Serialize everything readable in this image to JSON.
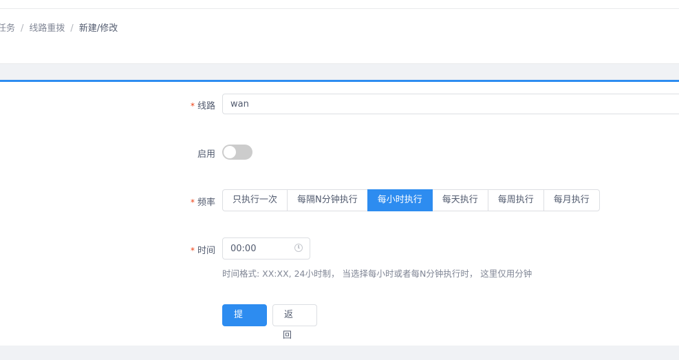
{
  "breadcrumb": {
    "items": [
      "任务",
      "线路重拨",
      "新建/修改"
    ],
    "separator": "/"
  },
  "form": {
    "line": {
      "label": "线路",
      "required": true,
      "value": "wan"
    },
    "enable": {
      "label": "启用",
      "on": false
    },
    "frequency": {
      "label": "频率",
      "required": true,
      "options": [
        "只执行一次",
        "每隔N分钟执行",
        "每小时执行",
        "每天执行",
        "每周执行",
        "每月执行"
      ],
      "selected": "每小时执行"
    },
    "time": {
      "label": "时间",
      "required": true,
      "value": "00:00",
      "icon": "clock-icon",
      "hint": "时间格式: XX:XX, 24小时制， 当选择每小时或者每N分钟执行时， 这里仅用分钟"
    },
    "submit_label": "提 交",
    "back_label": "返 回"
  },
  "colors": {
    "accent": "#2d8cf0",
    "required": "#ed4014",
    "switch_off": "#cccccc"
  }
}
